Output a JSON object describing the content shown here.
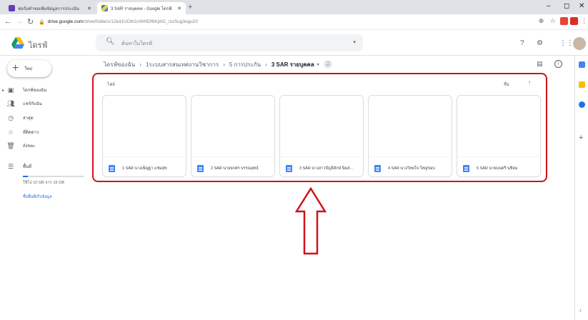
{
  "browser": {
    "tabs": [
      {
        "title": "ฟอร์มคำขอเพิ่มข้อมูลการประเมิน",
        "icon": "google-forms-icon",
        "active": false
      },
      {
        "title": "3 SAR รายบุคคล - Google ไดรฟ์",
        "icon": "google-drive-icon",
        "active": true
      }
    ],
    "new_tab": "+",
    "url_host": "drive.google.com",
    "url_path": "/drive/folders/12kd1UObI1nWHDf6KphC_luz5ug3ogu20",
    "window_controls": [
      "–",
      "◻",
      "✕"
    ]
  },
  "drive": {
    "app_name": "ไดรฟ์",
    "search_placeholder": "ค้นหาในไดรฟ์",
    "new_button": "ใหม่",
    "sidebar": [
      {
        "label": "ไดรฟ์ของฉัน",
        "icon": "my-drive-icon"
      },
      {
        "label": "แชร์กับฉัน",
        "icon": "shared-icon"
      },
      {
        "label": "ล่าสุด",
        "icon": "recent-icon"
      },
      {
        "label": "ที่ติดดาว",
        "icon": "star-icon"
      },
      {
        "label": "ถังขยะ",
        "icon": "trash-icon"
      },
      {
        "label": "พื้นที่",
        "icon": "storage-icon"
      }
    ],
    "storage_text": "ใช้ไป 10 GB จาก 15 GB",
    "storage_fraction": 0.08,
    "buy_storage": "ซื้อพื้นที่เก็บข้อมูล",
    "breadcrumb": [
      "ไดรฟ์ของฉัน",
      "1ระบบสารสนเทศงานวิชาการ",
      "5 การประกัน",
      "3 SAR รายบุคคล"
    ],
    "section_label": "ไฟล์",
    "sort_label": "ชื่อ",
    "files": [
      {
        "name": "1 SAR นางเพ็ญฐา แช่มสุข"
      },
      {
        "name": "2 SAR นายยกศร บรรณยุทธ์"
      },
      {
        "name": "3 SAR นางสาวปัญจิลักษ์ นิ่มส..."
      },
      {
        "name": "4 SAR นางวิทยใจ ใหญ่ขอบ"
      },
      {
        "name": "5 SAR นายมนตรี นุชิลม"
      }
    ]
  },
  "colors": {
    "highlight": "#d0111b",
    "drive_blue": "#4285f4",
    "doc_blue": "#4285f4"
  }
}
